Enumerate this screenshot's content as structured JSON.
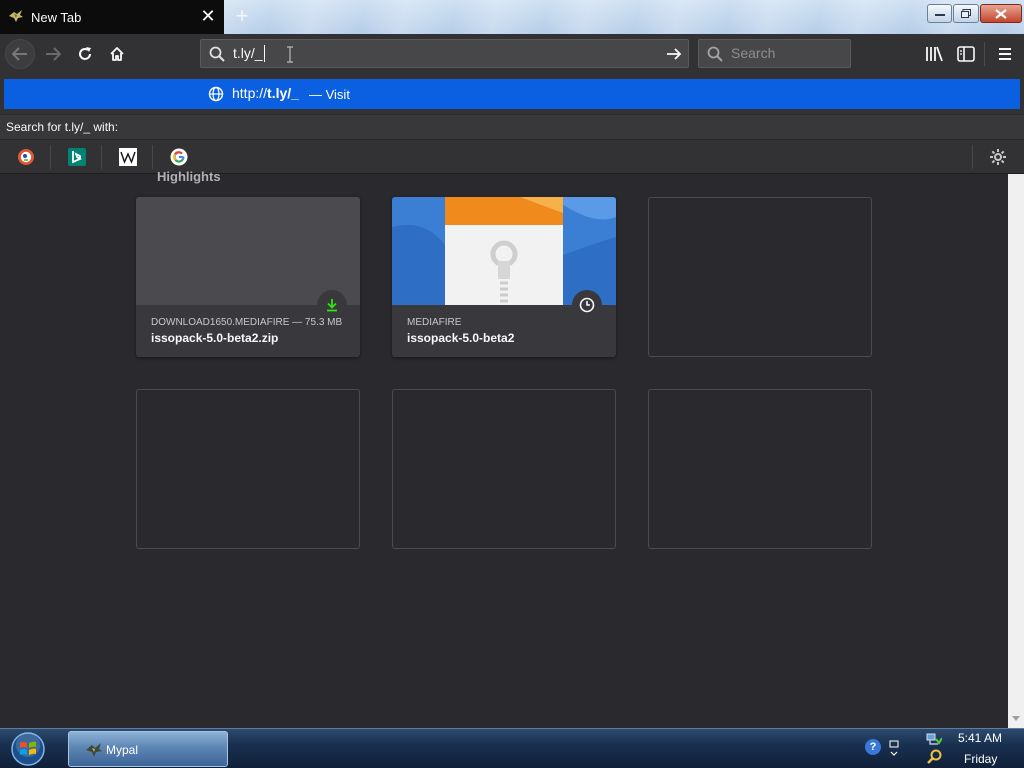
{
  "tab": {
    "title": "New Tab",
    "close_symbol": "✕",
    "new_tab_symbol": "+"
  },
  "navbar": {
    "url_value": "t.ly/_",
    "search_placeholder": "Search"
  },
  "dropdown": {
    "suggestion_url_prefix": "http://",
    "suggestion_url_host": "t.ly/_",
    "suggestion_action": "— Visit",
    "search_with_label": "Search for t.ly/_ with:",
    "engines": [
      "duckduckgo-icon",
      "bing-icon",
      "wikipedia-icon",
      "google-icon"
    ]
  },
  "content": {
    "section_title": "Highlights",
    "cards": [
      {
        "meta": "DOWNLOAD1650.MEDIAFIRE — 75.3 MB",
        "title": "issopack-5.0-beta2.zip",
        "badge": "download-icon"
      },
      {
        "meta": "MEDIAFIRE",
        "title": "issopack-5.0-beta2",
        "badge": "clock-icon"
      }
    ]
  },
  "taskbar": {
    "window_label": "Mypal",
    "help_symbol": "?",
    "time": "5:41 AM",
    "day": "Friday"
  },
  "colors": {
    "accent": "#0a60e0",
    "toolbar": "#323234",
    "content_bg": "#2a2a2e",
    "download_green": "#30e60b"
  }
}
